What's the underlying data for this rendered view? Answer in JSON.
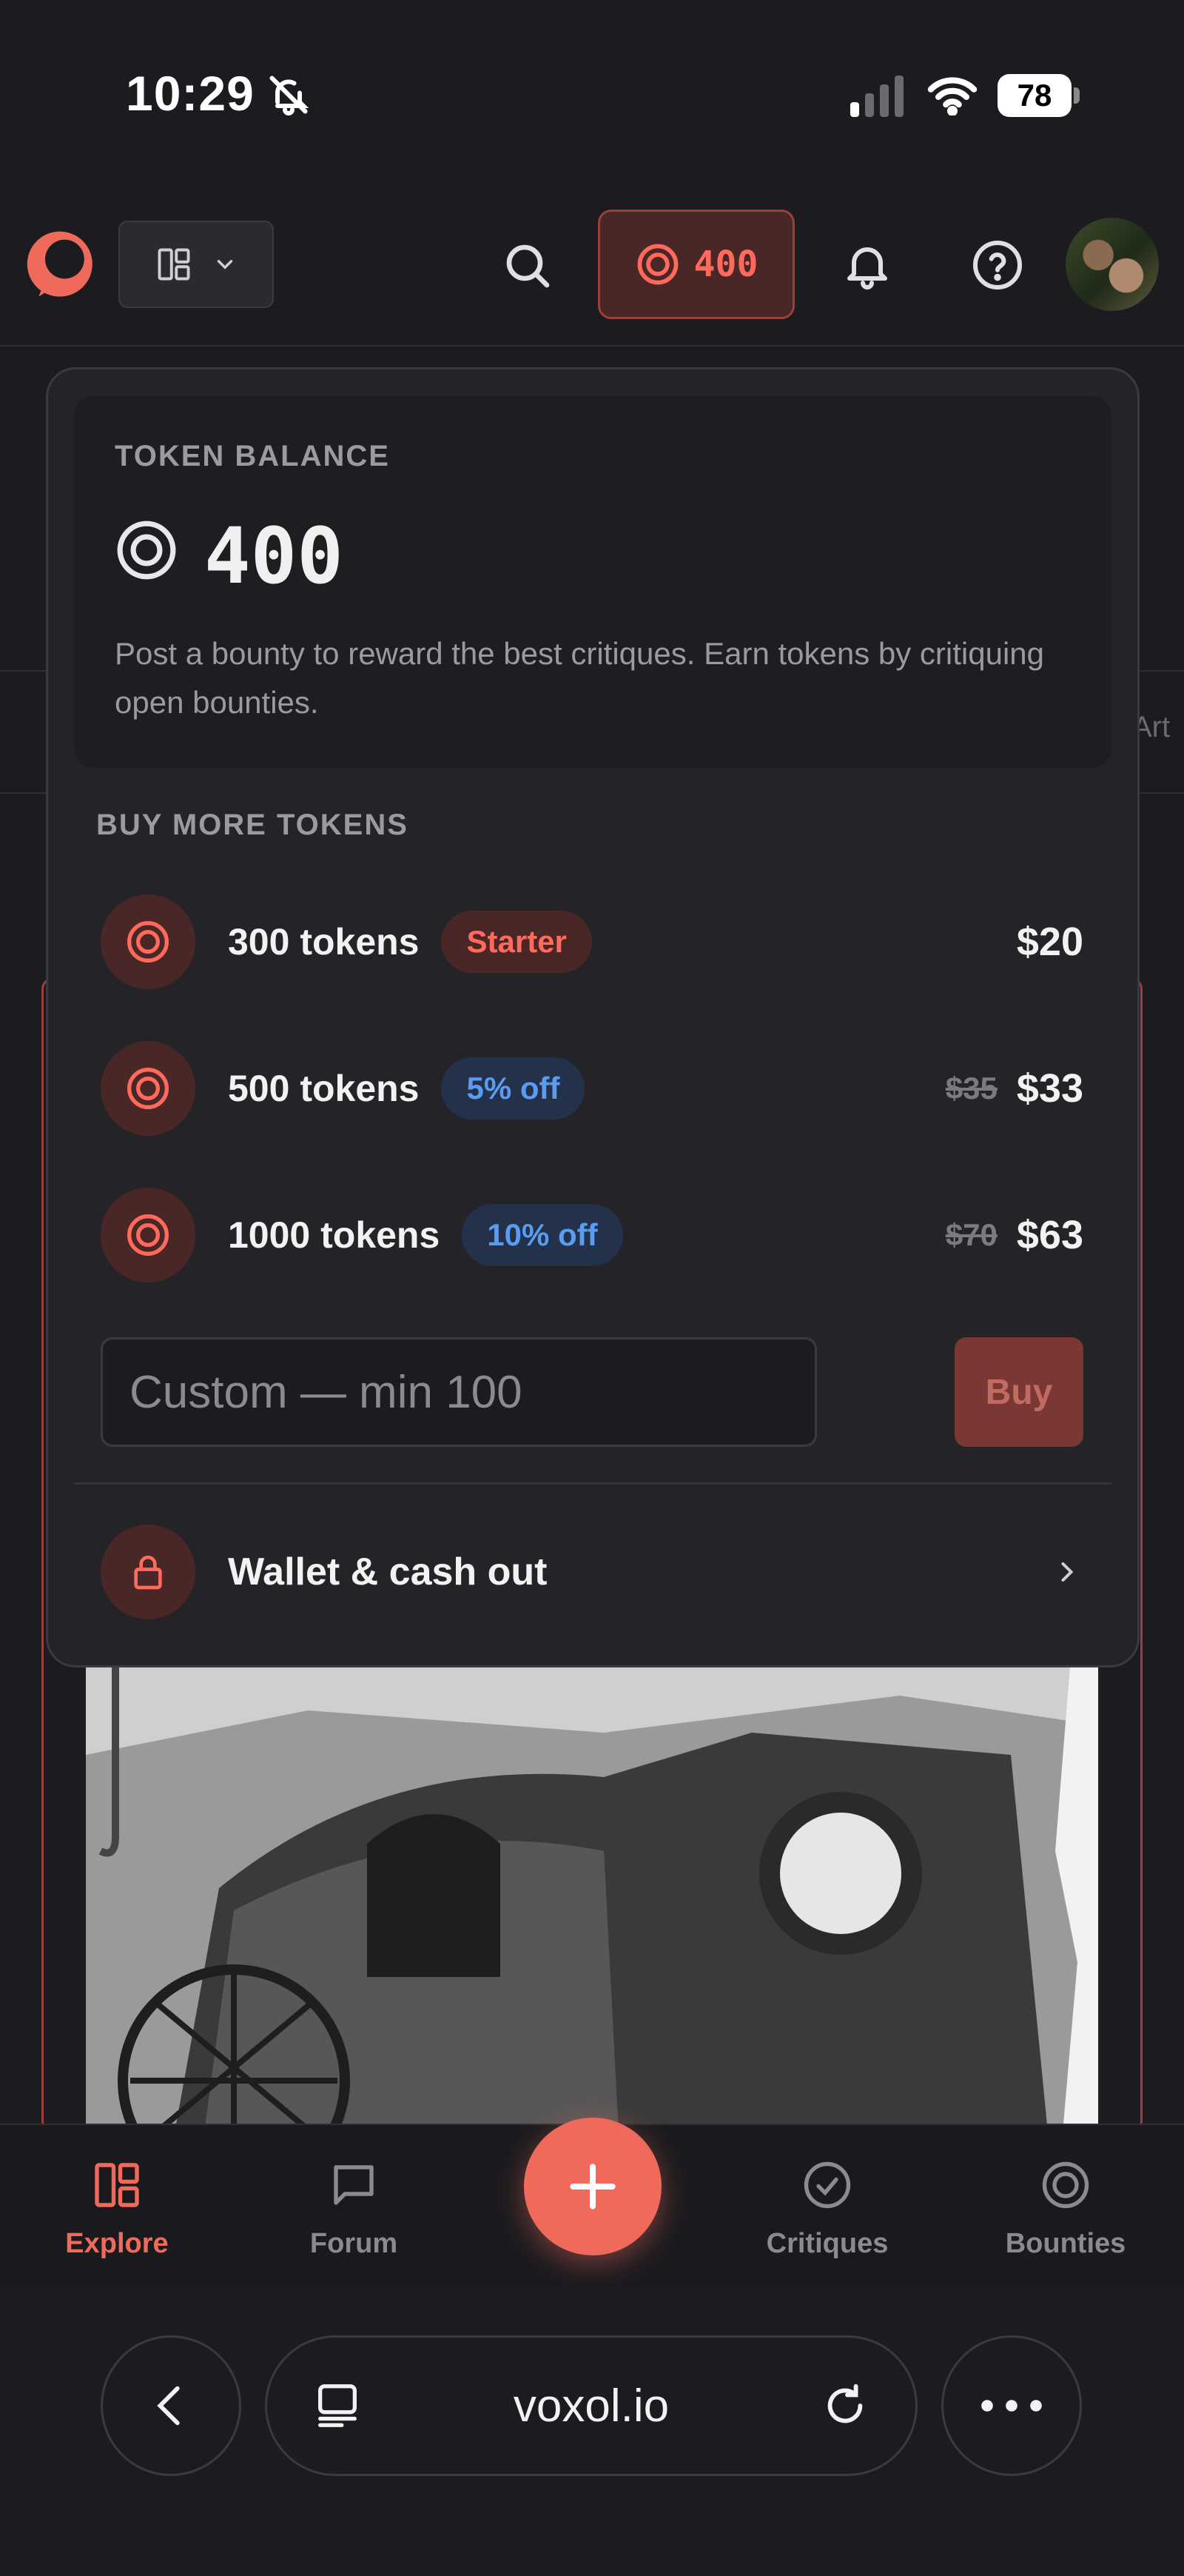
{
  "status_bar": {
    "time": "10:29",
    "battery": "78",
    "icons": [
      "bell-slash-icon",
      "signal-icon",
      "wifi-icon",
      "battery-icon"
    ]
  },
  "header": {
    "token_count": "400",
    "icons": [
      "logo-icon",
      "layout-grid-icon",
      "chevron-down-icon",
      "search-icon",
      "token-icon",
      "bell-icon",
      "help-icon"
    ]
  },
  "background": {
    "tab_partial": "Art"
  },
  "token_panel": {
    "balance_label": "TOKEN BALANCE",
    "balance_value": "400",
    "description": "Post a bounty to reward the best critiques. Earn tokens by critiquing open bounties.",
    "buy_label": "BUY MORE TOKENS",
    "packages": [
      {
        "name": "300 tokens",
        "badge": "Starter",
        "badge_style": "red",
        "old_price": "",
        "price": "$20"
      },
      {
        "name": "500 tokens",
        "badge": "5% off",
        "badge_style": "blue",
        "old_price": "$35",
        "price": "$33"
      },
      {
        "name": "1000 tokens",
        "badge": "10% off",
        "badge_style": "blue",
        "old_price": "$70",
        "price": "$63"
      }
    ],
    "custom_placeholder": "Custom — min 100",
    "buy_button": "Buy",
    "wallet_label": "Wallet & cash out"
  },
  "tabbar": {
    "items": [
      {
        "label": "Explore",
        "icon": "explore-icon",
        "active": true
      },
      {
        "label": "Forum",
        "icon": "forum-icon",
        "active": false
      },
      {
        "label": "Critiques",
        "icon": "critiques-icon",
        "active": false
      },
      {
        "label": "Bounties",
        "icon": "bounties-icon",
        "active": false
      }
    ],
    "fab_icon": "plus-icon"
  },
  "browser": {
    "url": "voxol.io",
    "icons": [
      "back-icon",
      "tabs-icon",
      "reload-icon",
      "more-icon"
    ]
  },
  "colors": {
    "accent": "#f06a5c",
    "accent_dark": "#4a2727",
    "blue_badge": "#5b9bf0",
    "background": "#1c1c20",
    "panel": "#242428"
  }
}
